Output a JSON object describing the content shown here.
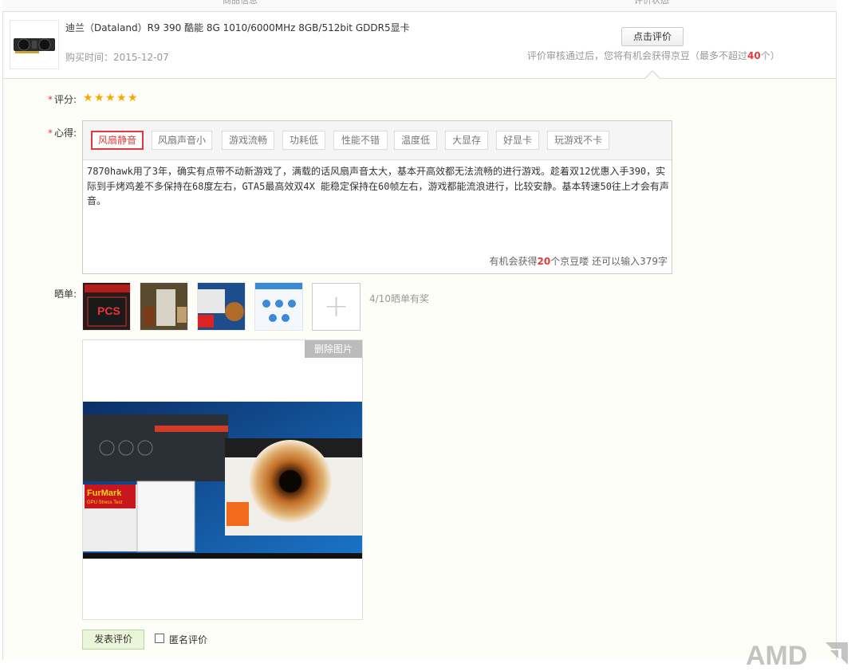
{
  "columns": {
    "product": "商品信息",
    "status": "评价状态"
  },
  "product": {
    "name": "迪兰（Dataland）R9 390 酷能 8G 1010/6000MHz 8GB/512bit GDDR5显卡",
    "purchase_date": "购买时间：2015-12-07",
    "rate_button": "点击评价",
    "reward_prefix": "评价审核通过后，您将有机会获得京豆（最多不超过",
    "reward_max": "40",
    "reward_suffix": "个）"
  },
  "form": {
    "score_label": "评分:",
    "score_value": 5,
    "feeling_label": "心得:",
    "tags": [
      {
        "label": "风扇静音",
        "selected": true
      },
      {
        "label": "风扇声音小",
        "selected": false
      },
      {
        "label": "游戏流畅",
        "selected": false
      },
      {
        "label": "功耗低",
        "selected": false
      },
      {
        "label": "性能不错",
        "selected": false
      },
      {
        "label": "温度低",
        "selected": false
      },
      {
        "label": "大显存",
        "selected": false
      },
      {
        "label": "好显卡",
        "selected": false
      },
      {
        "label": "玩游戏不卡",
        "selected": false
      }
    ],
    "review_text": "7870hawk用了3年，确实有点带不动新游戏了，满载的话风扇声音太大，基本开高效都无法流畅的进行游戏。趁着双12优惠入手390，实际到手烤鸡差不多保持在68度左右，GTA5最高效双4X 能稳定保持在60帧左右，游戏都能流浪进行，比较安静。基本转速50往上才会有声音。",
    "counter_prefix": "有机会获得",
    "counter_beans": "20",
    "counter_mid": "个京豆喽 还可以输入",
    "counter_remaining": "379",
    "counter_suffix": "字",
    "photos_label": "晒单:",
    "photo_count_text": "4/10晒单有奖",
    "delete_photo": "删除图片",
    "submit": "发表评价",
    "anonymous": "匿名评价"
  },
  "screenshot_texts": {
    "furmark": "FurMark",
    "furmark_sub": "GPU Stress Test"
  },
  "logo": "AMD",
  "colors": {
    "accent": "#e4393c",
    "star": "#f7a800",
    "submit_bg": "#eaf5d9"
  }
}
